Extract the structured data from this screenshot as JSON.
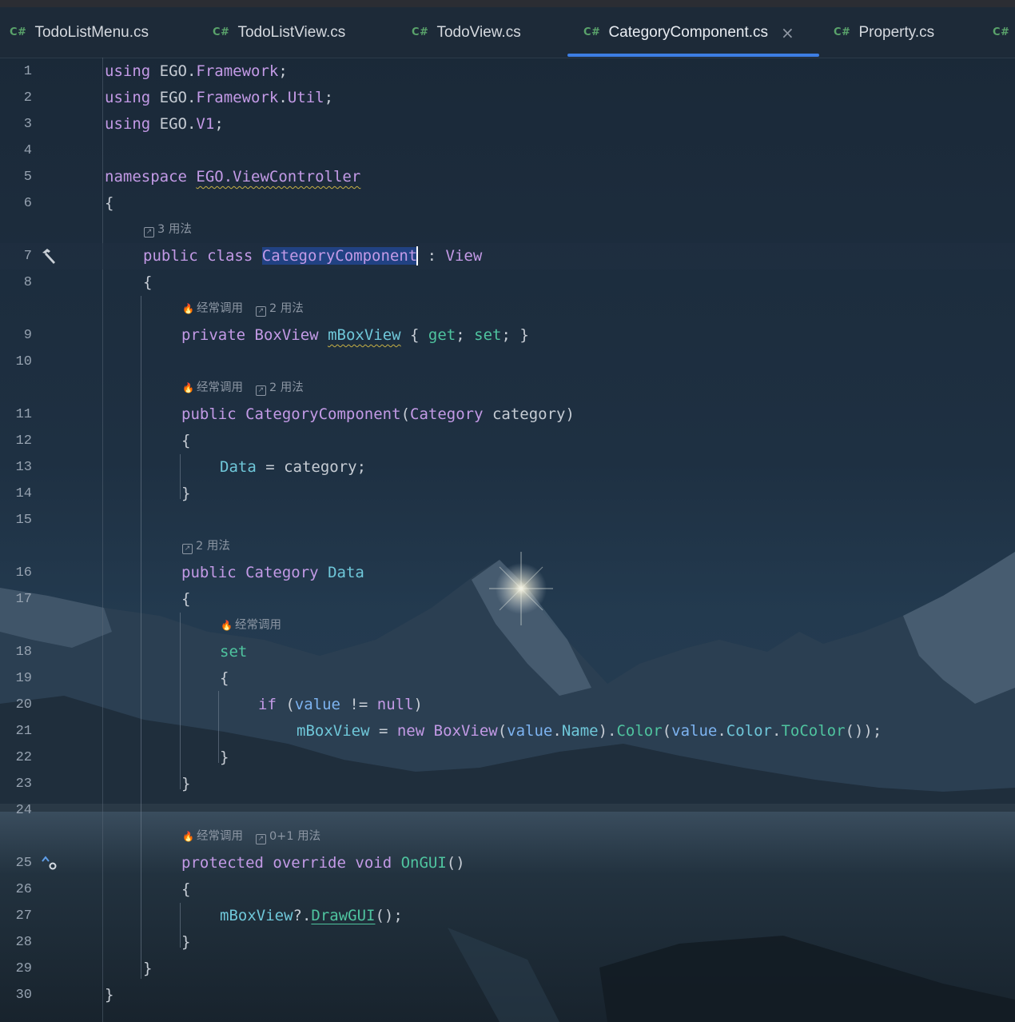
{
  "tabs": [
    {
      "lang": "C#",
      "label": "TodoListMenu.cs"
    },
    {
      "lang": "C#",
      "label": "TodoListView.cs"
    },
    {
      "lang": "C#",
      "label": "TodoView.cs"
    },
    {
      "lang": "C#",
      "label": "CategoryComponent.cs",
      "active": true,
      "close": "×"
    },
    {
      "lang": "C#",
      "label": "Property.cs"
    },
    {
      "lang": "C#",
      "label": ""
    }
  ],
  "hints": {
    "usages_3": "3 用法",
    "usages_2": "2 用法",
    "usages_0_1": "0+1 用法",
    "frequent": "经常调用"
  },
  "gutter_icons": {
    "line7": "hammer-icon",
    "line25": "override-up-arrow-icon"
  },
  "lines": {
    "n1": "1",
    "n2": "2",
    "n3": "3",
    "n4": "4",
    "n5": "5",
    "n6": "6",
    "n7": "7",
    "n8": "8",
    "n9": "9",
    "n10": "10",
    "n11": "11",
    "n12": "12",
    "n13": "13",
    "n14": "14",
    "n15": "15",
    "n16": "16",
    "n17": "17",
    "n18": "18",
    "n19": "19",
    "n20": "20",
    "n21": "21",
    "n22": "22",
    "n23": "23",
    "n24": "24",
    "n25": "25",
    "n26": "26",
    "n27": "27",
    "n28": "28",
    "n29": "29",
    "n30": "30"
  },
  "code": {
    "l1": [
      "using",
      " EGO",
      ".",
      "Framework",
      ";"
    ],
    "l2": [
      "using",
      " EGO",
      ".",
      "Framework",
      ".",
      "Util",
      ";"
    ],
    "l3": [
      "using",
      " EGO",
      ".",
      "V1",
      ";"
    ],
    "l5": [
      "namespace",
      " ",
      "EGO.ViewController"
    ],
    "l6": "{",
    "l7": [
      "public",
      " ",
      "class",
      " ",
      "CategoryComponent",
      " : ",
      "View"
    ],
    "l8": "{",
    "l9": [
      "private",
      " ",
      "BoxView",
      " ",
      "mBoxView",
      " { ",
      "get",
      "; ",
      "set",
      "; }"
    ],
    "l11": [
      "public",
      " ",
      "CategoryComponent",
      "(",
      "Category",
      " category)"
    ],
    "l12": "{",
    "l13": [
      "Data",
      " = category;"
    ],
    "l14": "}",
    "l16": [
      "public",
      " ",
      "Category",
      " ",
      "Data"
    ],
    "l17": "{",
    "l18": "set",
    "l19": "{",
    "l20": [
      "if",
      " (",
      "value",
      " != ",
      "null",
      ")"
    ],
    "l21": [
      "mBoxView",
      " = ",
      "new",
      " ",
      "BoxView",
      "(",
      "value",
      ".",
      "Name",
      ").",
      "Color",
      "(",
      "value",
      ".",
      "Color",
      ".",
      "ToColor",
      "());"
    ],
    "l22": "}",
    "l23": "}",
    "l25": [
      "protected",
      " ",
      "override",
      " ",
      "void",
      " ",
      "OnGUI",
      "()"
    ],
    "l26": "{",
    "l27": [
      "mBoxView",
      "?.",
      "DrawGUI",
      "();"
    ],
    "l28": "}",
    "l29": "}",
    "l30": "}"
  },
  "colors": {
    "keyword": "#c39ae6",
    "method": "#4fc49f",
    "property": "#6fc7d9",
    "value": "#7db3f0",
    "plain": "#c6ccd4",
    "tab_underline": "#3d7ee3",
    "selection": "#214283"
  }
}
